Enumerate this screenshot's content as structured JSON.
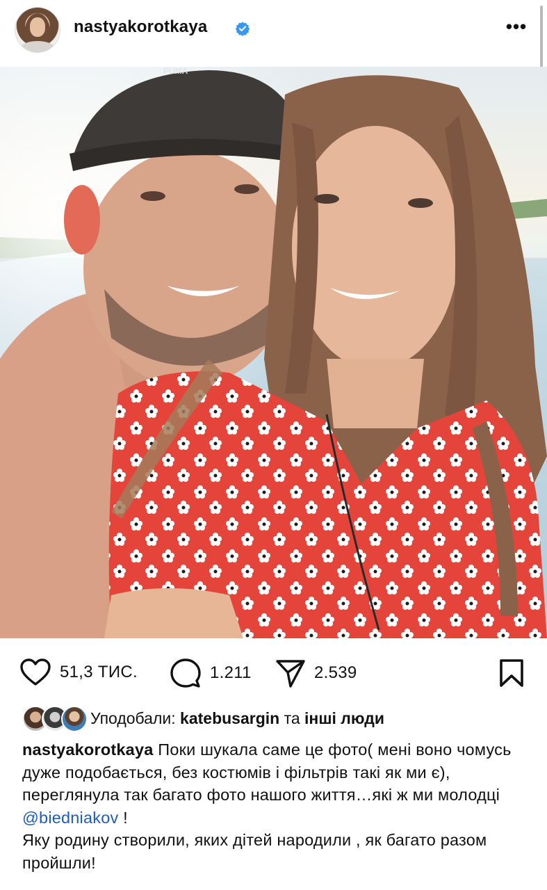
{
  "header": {
    "username": "nastyakorotkaya",
    "verified": true,
    "avatar_icon": "profile-avatar",
    "more_icon": "more-dots-icon",
    "more_label": "•••"
  },
  "photo": {
    "description_icon": "post-photo",
    "cap_text": "PUMA"
  },
  "actions": {
    "likes_count": "51,3 ТИС.",
    "comments_count": "1.211",
    "shares_count": "2.539",
    "like_icon": "heart-icon",
    "comment_icon": "comment-bubble-icon",
    "share_icon": "paper-plane-icon",
    "save_icon": "bookmark-icon"
  },
  "liked_by": {
    "prefix": "Уподобали:",
    "user": "katebusargin",
    "joiner": "та",
    "others": "інші люди"
  },
  "caption": {
    "user": "nastyakorotkaya",
    "text_part1": "Поки шукала саме це фото( мені воно чомусь дуже подобається, без костюмів і фільтрів такі як ми є), переглянула так багато фото нашого життя…які ж ми молодці ",
    "mention": "@biedniakov",
    "text_part2": " !",
    "text_line2": "Яку родину створили, яких дітей народили , як багато разом пройшли!"
  },
  "colors": {
    "verified_blue": "#3897f0",
    "mention_blue": "#1f5db8",
    "dress_red": "#e8453c",
    "text": "#111111"
  }
}
